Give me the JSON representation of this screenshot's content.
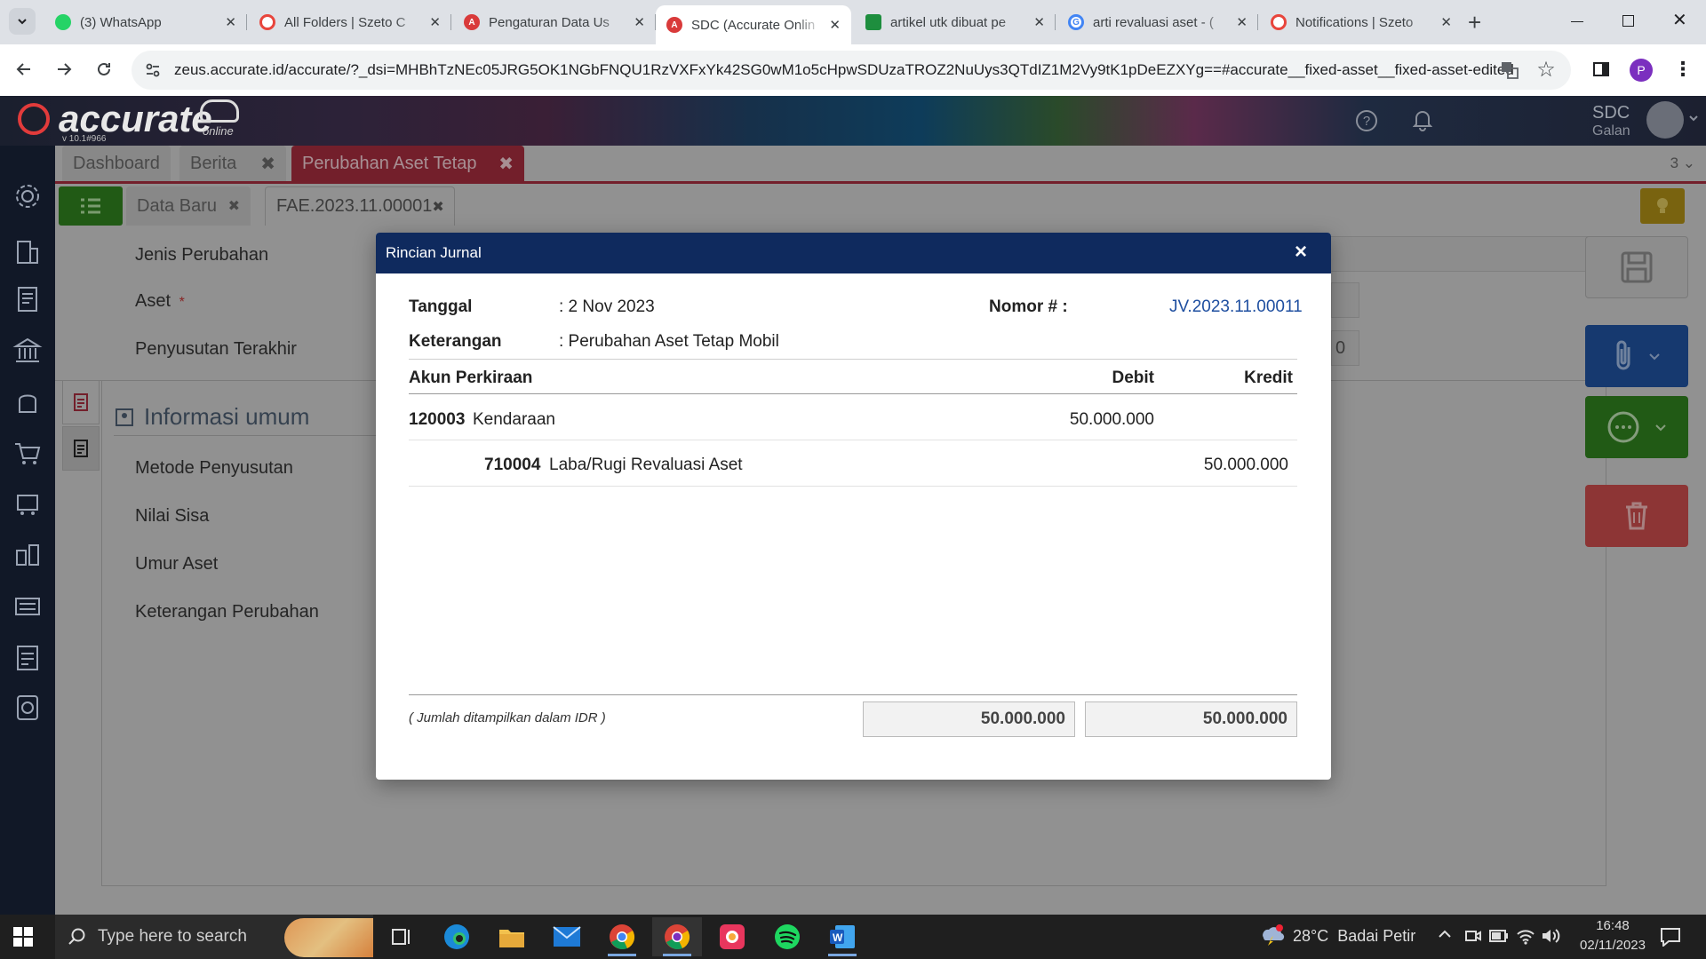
{
  "browser": {
    "tabs": [
      {
        "title": "(3) WhatsApp",
        "color": "#25d366"
      },
      {
        "title": "All Folders | Szeto C",
        "color": "#e8453c"
      },
      {
        "title": "Pengaturan Data Us",
        "color": "#d93a3a"
      },
      {
        "title": "SDC (Accurate Onlin",
        "color": "#d93a3a"
      },
      {
        "title": "artikel utk dibuat pe",
        "color": "#1e8e3e"
      },
      {
        "title": "arti revaluasi aset - (",
        "color": "#4285f4"
      },
      {
        "title": "Notifications | Szeto",
        "color": "#e8453c"
      }
    ],
    "url": "zeus.accurate.id/accurate/?_dsi=MHBhTzNEc05JRG5OK1NGbFNQU1RzVXFxYk42SG0wM1o5cHpwSDUzaTROZ2NuUys3QTdIZ1M2Vy9tK1pDeEZXYg==#accurate__fixed-asset__fixed-asset-edited",
    "profile_initial": "P"
  },
  "app": {
    "logo": "accurate",
    "logo_sub": "online",
    "version": "v 10.1#966",
    "user": {
      "name": "SDC",
      "sub": "Galan"
    },
    "top_tabs": [
      "Dashboard",
      "Berita",
      "Perubahan Aset Tetap"
    ],
    "tab_count": "3",
    "sub_tabs": [
      "Data Baru",
      "FAE.2023.11.00001"
    ],
    "form": {
      "labels": [
        "Jenis Perubahan",
        "Aset",
        "Penyusutan Terakhir"
      ],
      "required_mark": "*",
      "section_title": "Informasi umum",
      "section_labels": [
        "Metode Penyusutan",
        "Nilai Sisa",
        "Umur Aset",
        "Keterangan Perubahan"
      ],
      "partial_value": "0"
    }
  },
  "modal": {
    "title": "Rincian Jurnal",
    "close": "×",
    "tanggal_label": "Tanggal",
    "tanggal_value": ": 2 Nov 2023",
    "keterangan_label": "Keterangan",
    "keterangan_value": ": Perubahan Aset Tetap Mobil",
    "nomor_label": "Nomor # :",
    "nomor_value": "JV.2023.11.00011",
    "columns": {
      "account": "Akun Perkiraan",
      "debit": "Debit",
      "credit": "Kredit"
    },
    "rows": [
      {
        "code": "120003",
        "name": "Kendaraan",
        "debit": "50.000.000",
        "credit": ""
      },
      {
        "code": "710004",
        "name": "Laba/Rugi Revaluasi Aset",
        "debit": "",
        "credit": "50.000.000"
      }
    ],
    "currency_note": "( Jumlah ditampilkan dalam IDR )",
    "total_debit": "50.000.000",
    "total_credit": "50.000.000"
  },
  "taskbar": {
    "search_placeholder": "Type here to search",
    "weather": "28°C  Badai Petir",
    "time": "16:48",
    "date": "02/11/2023"
  }
}
